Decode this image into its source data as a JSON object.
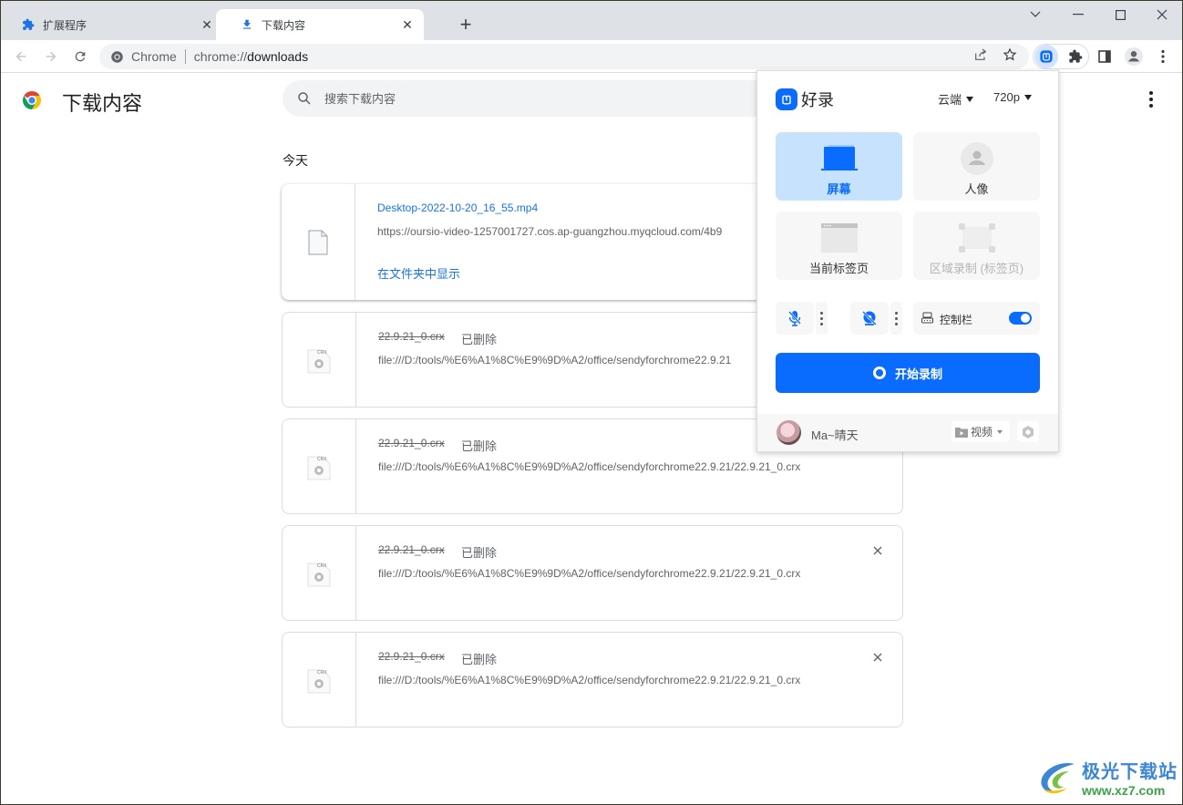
{
  "window": {
    "tabs": [
      {
        "label": "扩展程序",
        "icon": "puzzle-icon",
        "active": false
      },
      {
        "label": "下载内容",
        "icon": "download-icon",
        "active": true
      }
    ],
    "new_tab_label": "+",
    "controls": [
      "tab-search",
      "minimize",
      "maximize",
      "close"
    ]
  },
  "toolbar": {
    "site_label": "Chrome",
    "url_host": "chrome://",
    "url_path": "downloads"
  },
  "page": {
    "title": "下载内容",
    "search_placeholder": "搜索下载内容",
    "date_header": "今天"
  },
  "downloads": [
    {
      "name": "Desktop-2022-10-20_16_55.mp4",
      "url": "https://oursio-video-1257001727.cos.ap-guangzhou.myqcloud.com/4b9",
      "action": "在文件夹中显示",
      "status": "",
      "deleted": false,
      "icon": "file-icon"
    },
    {
      "name": "22.9.21_0.crx",
      "status": "已删除",
      "url": "file:///D:/tools/%E6%A1%8C%E9%9D%A2/office/sendyforchrome22.9.21",
      "deleted": true,
      "icon": "crx-file-icon"
    },
    {
      "name": "22.9.21_0.crx",
      "status": "已删除",
      "url": "file:///D:/tools/%E6%A1%8C%E9%9D%A2/office/sendyforchrome22.9.21/22.9.21_0.crx",
      "deleted": true,
      "icon": "crx-file-icon"
    },
    {
      "name": "22.9.21_0.crx",
      "status": "已删除",
      "url": "file:///D:/tools/%E6%A1%8C%E9%9D%A2/office/sendyforchrome22.9.21/22.9.21_0.crx",
      "deleted": true,
      "icon": "crx-file-icon",
      "remove_label": "×"
    },
    {
      "name": "22.9.21_0.crx",
      "status": "已删除",
      "url": "file:///D:/tools/%E6%A1%8C%E9%9D%A2/office/sendyforchrome22.9.21/22.9.21_0.crx",
      "deleted": true,
      "icon": "crx-file-icon",
      "remove_label": "×"
    }
  ],
  "popup": {
    "brand": "好录",
    "storage": "云端",
    "resolution": "720p",
    "modes": [
      {
        "label": "屏幕",
        "selected": true,
        "disabled": false
      },
      {
        "label": "人像",
        "selected": false,
        "disabled": false
      },
      {
        "label": "当前标签页",
        "selected": false,
        "disabled": false
      },
      {
        "label": "区域录制 (标签页)",
        "selected": false,
        "disabled": true
      }
    ],
    "mic_muted": true,
    "camera_off": true,
    "control_bar_label": "控制栏",
    "control_bar_on": true,
    "start_label": "开始录制",
    "username": "Ma~晴天",
    "library_label": "视频"
  },
  "watermark": {
    "name": "极光下载站",
    "url": "www.xz7.com"
  },
  "colors": {
    "accent": "#0a6cff",
    "link": "#1a73e8",
    "selected_mode_bg": "#c7e2fd"
  }
}
